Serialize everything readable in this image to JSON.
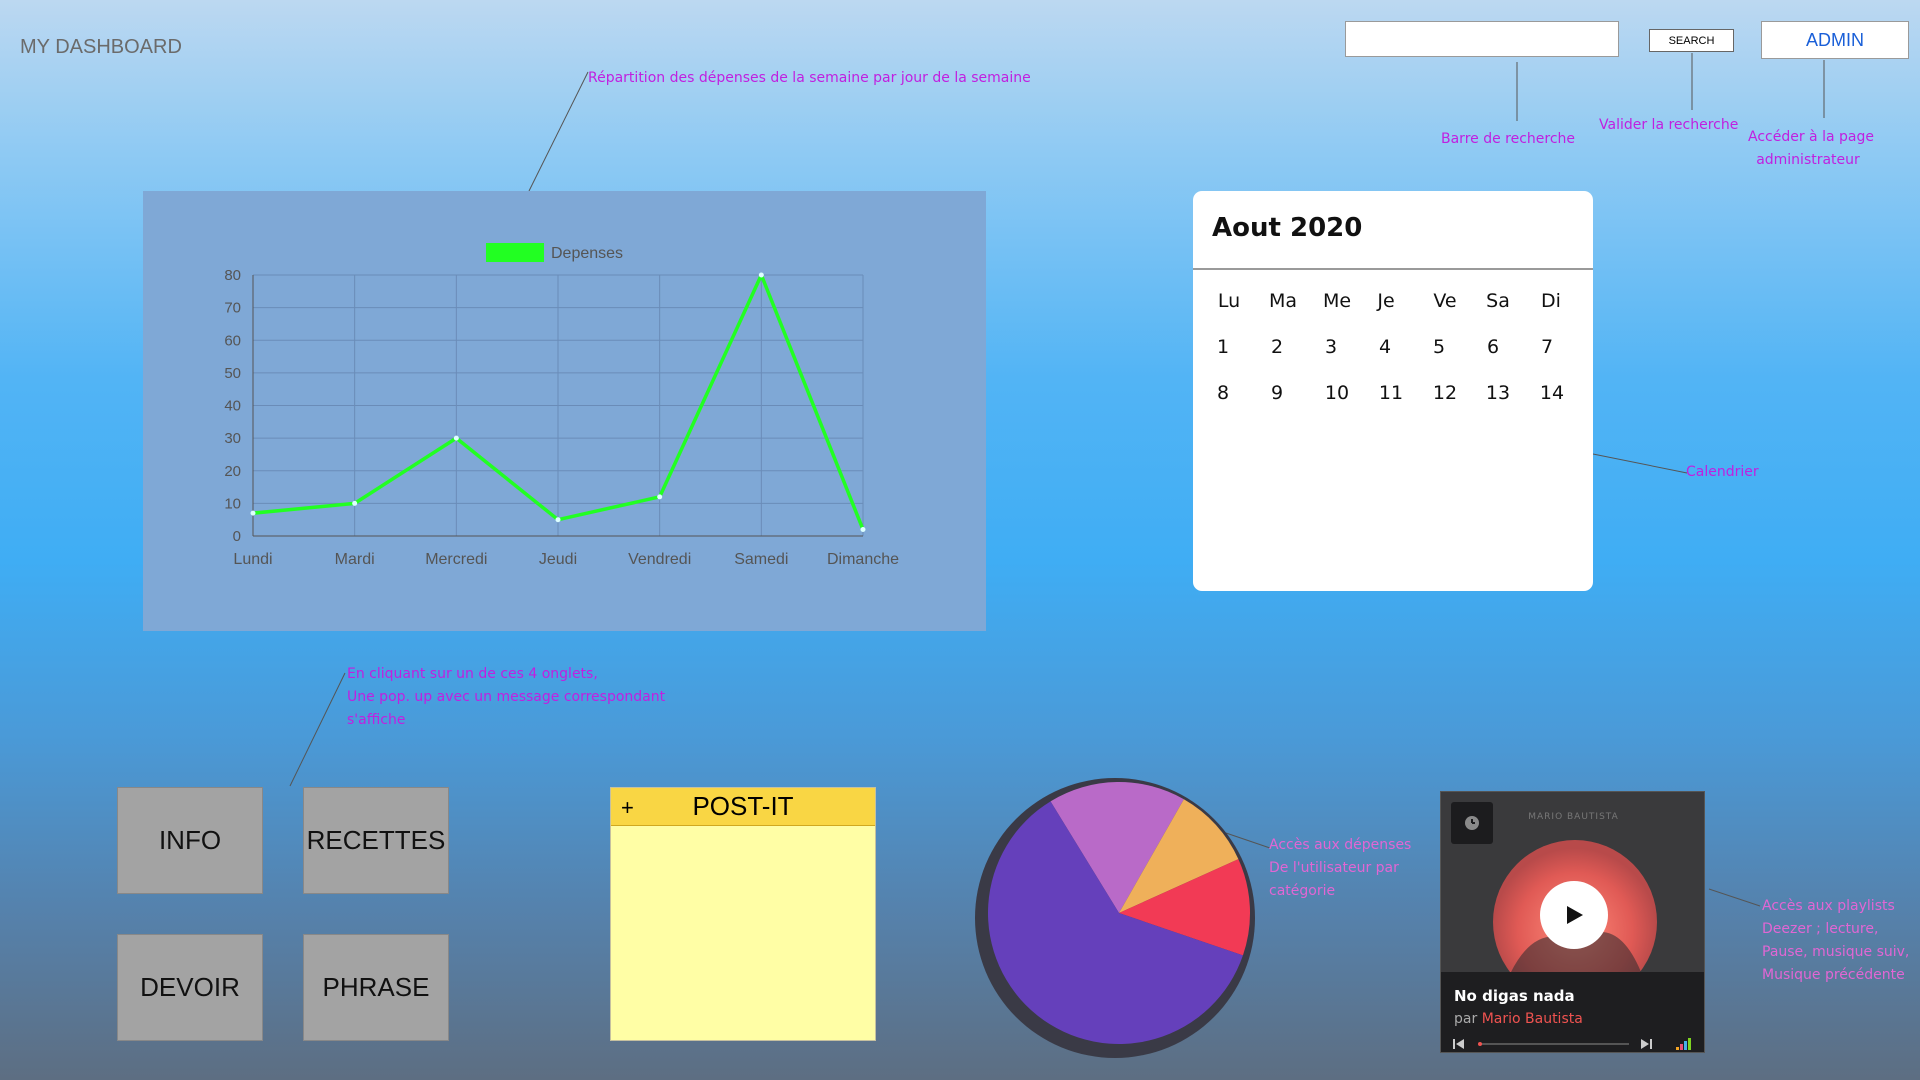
{
  "header": {
    "title": "MY DASHBOARD",
    "search": {
      "value": "",
      "placeholder": ""
    },
    "search_button": "SEARCH",
    "admin_button": "ADMIN"
  },
  "annotations": {
    "search_bar": "Barre de recherche",
    "search_validate": "Valider la recherche",
    "admin_line1": "Accéder à la page",
    "admin_line2": "administrateur",
    "chart": "Répartition des dépenses de la semaine par jour de la semaine",
    "calendar": "Calendrier",
    "tabs_line1": "En cliquant sur un de ces 4 onglets,",
    "tabs_line2": "Une pop. up avec un message correspondant",
    "tabs_line3": "s'affiche",
    "pie_line1": "Accès aux dépenses",
    "pie_line2": "De l'utilisateur par",
    "pie_line3": "catégorie",
    "player_line1": "Accès aux playlists",
    "player_line2": "Deezer ; lecture,",
    "player_line3": "Pause, musique suiv,",
    "player_line4": "Musique précédente"
  },
  "chart_data": {
    "type": "line",
    "categories": [
      "Lundi",
      "Mardi",
      "Mercredi",
      "Jeudi",
      "Vendredi",
      "Samedi",
      "Dimanche"
    ],
    "series": [
      {
        "name": "Depenses",
        "values": [
          7,
          10,
          30,
          5,
          12,
          80,
          2
        ],
        "color": "#22ff22"
      }
    ],
    "ylim": [
      0,
      80
    ],
    "yticks": [
      0,
      10,
      20,
      30,
      40,
      50,
      60,
      70,
      80
    ],
    "grid": true,
    "legend": "top-center"
  },
  "calendar": {
    "title": "Aout 2020",
    "weekdays": [
      "Lu",
      "Ma",
      "Me",
      "Je",
      "Ve",
      "Sa",
      "Di"
    ],
    "weeks": [
      [
        "1",
        "2",
        "3",
        "4",
        "5",
        "6",
        "7"
      ],
      [
        "8",
        "9",
        "10",
        "11",
        "12",
        "13",
        "14"
      ]
    ]
  },
  "tabs": {
    "info": "INFO",
    "recettes": "RECETTES",
    "devoir": "DEVOIR",
    "phrase": "PHRASE"
  },
  "postit": {
    "plus": "+",
    "title": "POST-IT"
  },
  "pie": {
    "slices": [
      {
        "value": 17,
        "color": "#b96ac8"
      },
      {
        "value": 10,
        "color": "#efb05a"
      },
      {
        "value": 12,
        "color": "#f23a55"
      },
      {
        "value": 61,
        "color": "#6540bb"
      }
    ],
    "rim_color": "#3a3a46"
  },
  "player": {
    "artist_caption": "MARIO BAUTISTA",
    "track": "No digas nada",
    "by": "par",
    "artist": "Mario Bautista"
  }
}
